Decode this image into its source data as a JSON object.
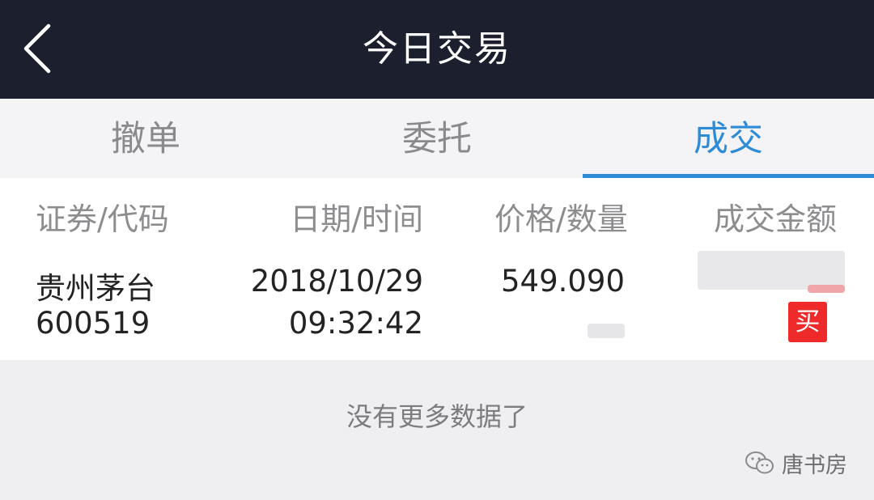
{
  "header": {
    "title": "今日交易",
    "back_icon": "chevron-left-icon"
  },
  "tabs": [
    {
      "label": "撤单",
      "active": false
    },
    {
      "label": "委托",
      "active": false
    },
    {
      "label": "成交",
      "active": true
    }
  ],
  "colors": {
    "header_bg": "#1b1f2e",
    "accent": "#2e8bd6",
    "buy_badge": "#ee2a2a"
  },
  "table": {
    "headers": [
      "证券/代码",
      "日期/时间",
      "价格/数量",
      "成交金额"
    ],
    "rows": [
      {
        "name": "贵州茅台",
        "code": "600519",
        "date": "2018/10/29",
        "time": "09:32:42",
        "price": "549.090",
        "side": "买"
      }
    ]
  },
  "footer": {
    "no_more": "没有更多数据了"
  },
  "watermark": {
    "text": "唐书房",
    "icon": "wechat-icon"
  }
}
